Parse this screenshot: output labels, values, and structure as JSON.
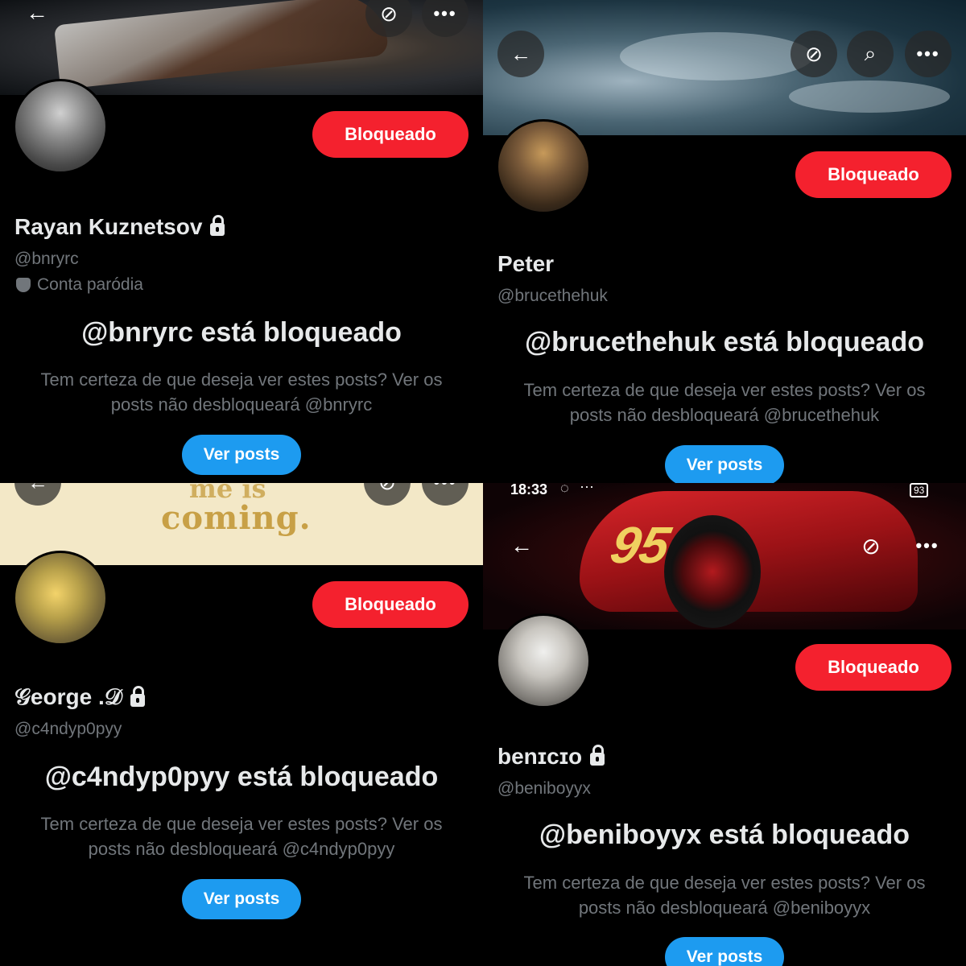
{
  "panels": [
    {
      "display_name": "Rayan Kuznetsov",
      "handle": "@bnryrc",
      "parody_label": "Conta paródia",
      "block_button": "Bloqueado",
      "blocked_title": "@bnryrc está bloqueado",
      "blocked_desc": "Tem certeza de que deseja ver estes posts? Ver os posts não desbloqueará @bnryrc",
      "view_posts": "Ver posts"
    },
    {
      "display_name": "Peter",
      "handle": "@brucethehuk",
      "block_button": "Bloqueado",
      "blocked_title": "@brucethehuk está bloqueado",
      "blocked_desc": "Tem certeza de que deseja ver estes posts? Ver os posts não desbloqueará @brucethehuk",
      "view_posts": "Ver posts"
    },
    {
      "display_name": "𝒢eorge .𝒟",
      "handle": "@c4ndyp0pyy",
      "banner_text": "coming.",
      "banner_text_partial": "me is",
      "block_button": "Bloqueado",
      "blocked_title": "@c4ndyp0pyy está bloqueado",
      "blocked_desc": "Tem certeza de que deseja ver estes posts? Ver os posts não desbloqueará @c4ndyp0pyy",
      "view_posts": "Ver posts"
    },
    {
      "display_name": "benɪcɪo",
      "handle": "@beniboyyx",
      "status_time": "18:33",
      "battery": "93",
      "banner_car_number": "95",
      "block_button": "Bloqueado",
      "blocked_title": "@beniboyyx está bloqueado",
      "blocked_desc": "Tem certeza de que deseja ver estes posts? Ver os posts não desbloqueará @beniboyyx",
      "view_posts": "Ver posts"
    }
  ],
  "icons": {
    "back": "←",
    "grok": "⊘",
    "search": "⌕",
    "more": "•••"
  },
  "colors": {
    "background": "#000000",
    "blocked_red": "#f4212e",
    "primary_blue": "#1d9bf0",
    "muted_text": "#71767b",
    "main_text": "#e7e9ea"
  }
}
